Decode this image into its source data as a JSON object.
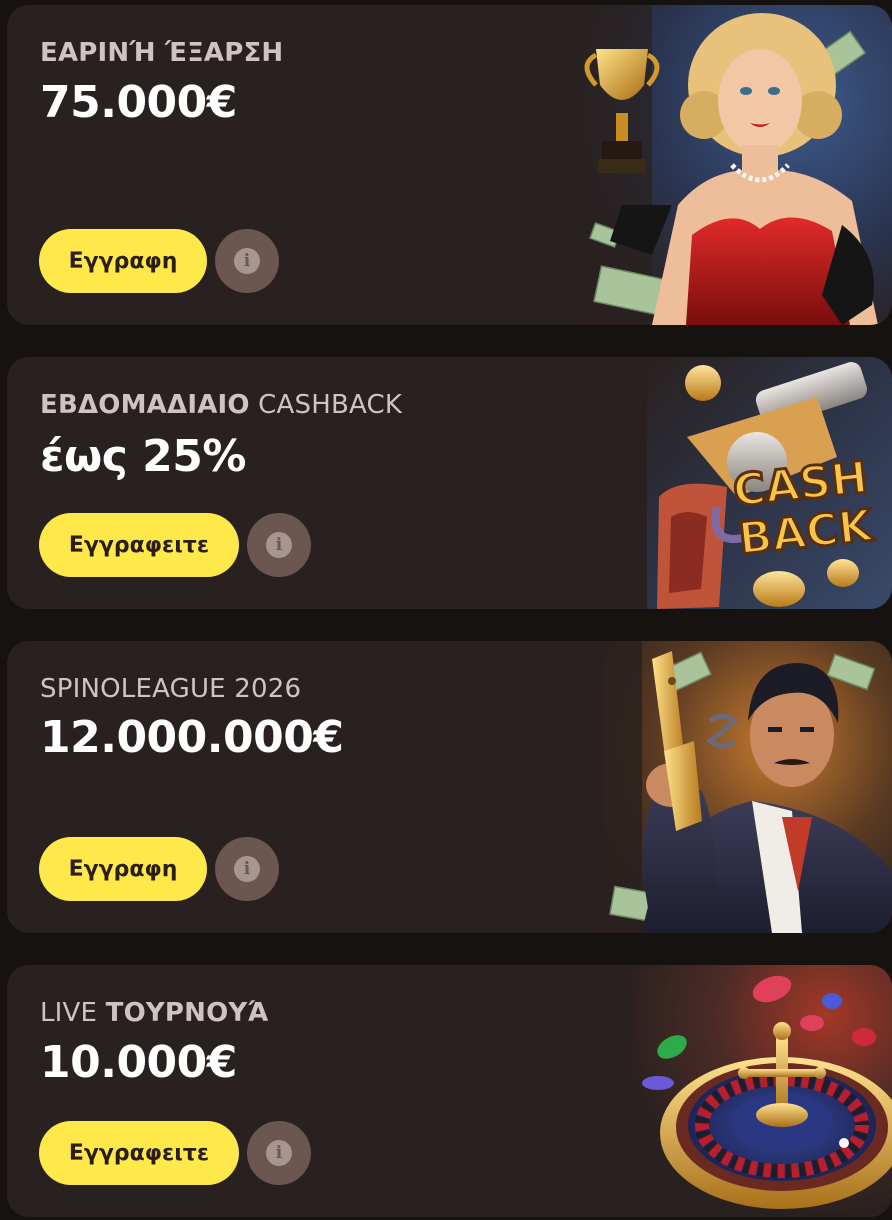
{
  "promotions": [
    {
      "title_bold": "ΕΑΡΙΝΉ ΈΞΑΡΣΗ",
      "title_regular": "",
      "amount": "75.000€",
      "cta_label": "Εγγραφη",
      "info_glyph": "i",
      "art_icon": "glamour-woman-trophy-icon"
    },
    {
      "title_bold": "ΕΒΔΟΜΑΔΙΑΙΟ",
      "title_regular": " CASHBACK",
      "amount": "έως 25%",
      "cta_label": "Εγγραφειτε",
      "info_glyph": "i",
      "art_icon": "cashback-revolver-icon",
      "art_text_1": "CASH",
      "art_text_2": "BACK"
    },
    {
      "title_bold": "",
      "title_regular": "SPINOLEAGUE 2026",
      "amount": "12.000.000€",
      "cta_label": "Εγγραφη",
      "info_glyph": "i",
      "art_icon": "mobster-with-gold-pistol-icon"
    },
    {
      "title_bold": "ΤΟΥΡΝΟΥΆ",
      "title_regular": "LIVE ",
      "amount": "10.000€",
      "cta_label": "Εγγραφειτε",
      "info_glyph": "i",
      "art_icon": "roulette-wheel-chips-icon"
    }
  ],
  "colors": {
    "page_bg": "#161210",
    "card_bg": "#29211f",
    "cta_bg": "#ffe94a",
    "cta_text": "#2a1e18",
    "info_bg": "#6b5650",
    "title_text": "#cfc4c2",
    "amount_text": "#ffffff"
  }
}
